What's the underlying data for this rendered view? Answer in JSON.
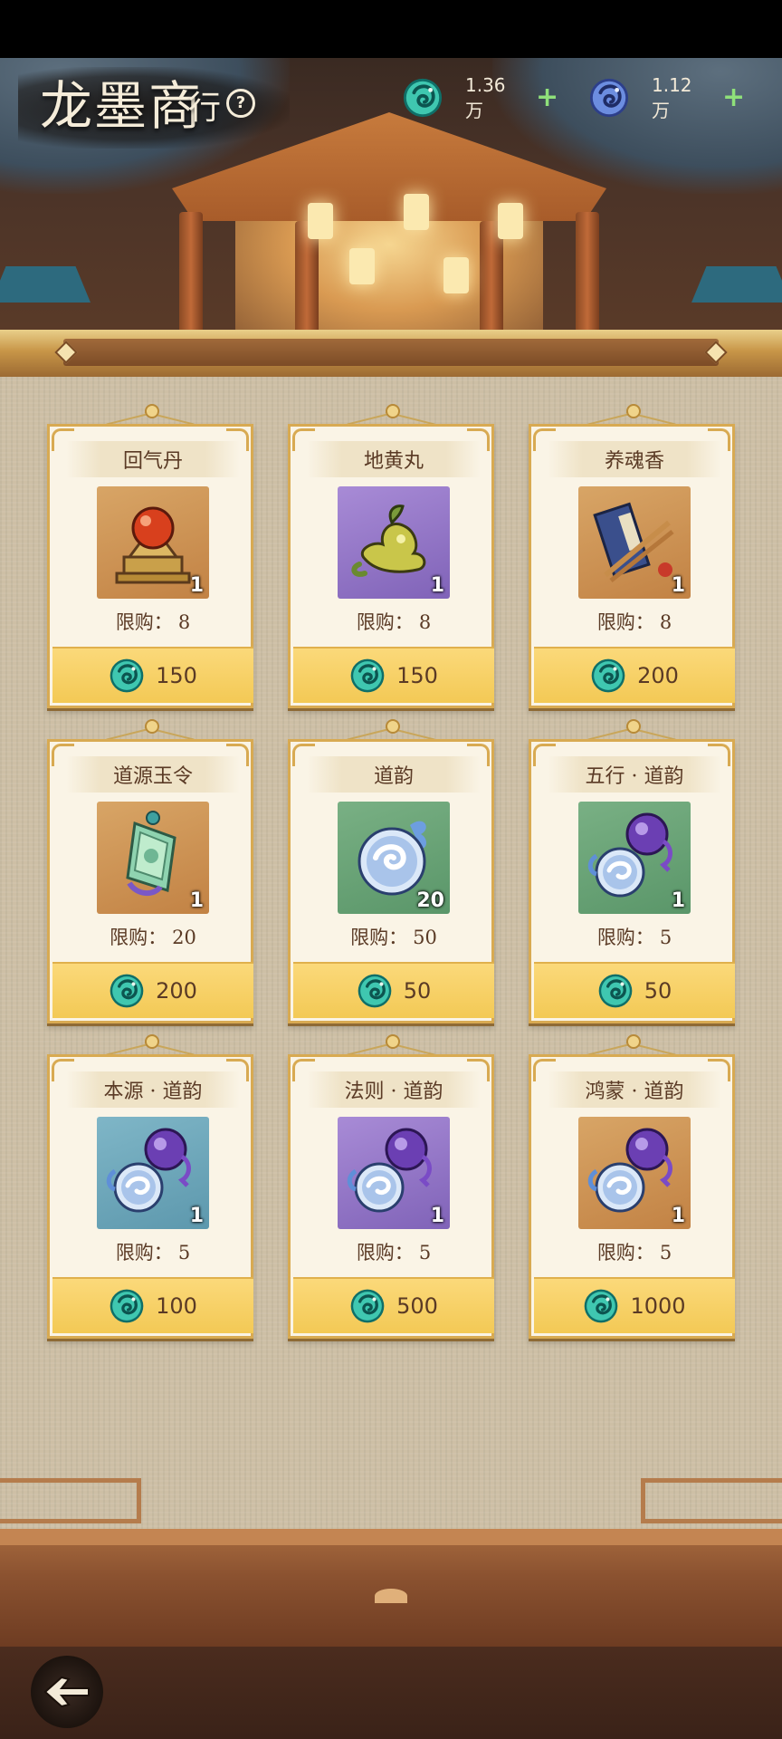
{
  "header": {
    "title_main": "龙墨商",
    "title_small": "行",
    "help_glyph": "?",
    "currencies": [
      {
        "icon": "jade-dragon-coin-icon",
        "amount": "1.36万",
        "plus": "+"
      },
      {
        "icon": "blue-dragon-coin-icon",
        "amount": "1.12万",
        "plus": "+"
      }
    ]
  },
  "colors": {
    "card_border": "#d8aa52",
    "buy_button": "#f3c955",
    "text_brown": "#5a3a25",
    "plus_green": "#8fe07a"
  },
  "shop": {
    "limit_label": "限购：",
    "price_icon": "jade-dragon-coin-icon",
    "items": [
      {
        "name": "回气丹",
        "icon": "red-orb-pedestal-icon",
        "bg": "orange",
        "qty": "1",
        "limit": "8",
        "price": "150"
      },
      {
        "name": "地黄丸",
        "icon": "yellow-fruit-icon",
        "bg": "purple",
        "qty": "1",
        "limit": "8",
        "price": "150"
      },
      {
        "name": "养魂香",
        "icon": "incense-bundle-icon",
        "bg": "orange",
        "qty": "1",
        "limit": "8",
        "price": "200"
      },
      {
        "name": "道源玉令",
        "icon": "jade-token-icon",
        "bg": "orange",
        "qty": "1",
        "limit": "20",
        "price": "200"
      },
      {
        "name": "道韵",
        "icon": "swirl-orb-icon",
        "bg": "green",
        "qty": "20",
        "limit": "50",
        "price": "50"
      },
      {
        "name": "五行 · 道韵",
        "icon": "twin-orbs-icon",
        "bg": "green",
        "qty": "1",
        "limit": "5",
        "price": "50"
      },
      {
        "name": "本源 · 道韵",
        "icon": "twin-orbs-icon",
        "bg": "blue",
        "qty": "1",
        "limit": "5",
        "price": "100"
      },
      {
        "name": "法则 · 道韵",
        "icon": "twin-orbs-icon",
        "bg": "purple",
        "qty": "1",
        "limit": "5",
        "price": "500"
      },
      {
        "name": "鸿蒙 · 道韵",
        "icon": "twin-orbs-icon",
        "bg": "orange",
        "qty": "1",
        "limit": "5",
        "price": "1000"
      }
    ]
  },
  "footer": {
    "back_icon": "back-arrow-icon"
  }
}
